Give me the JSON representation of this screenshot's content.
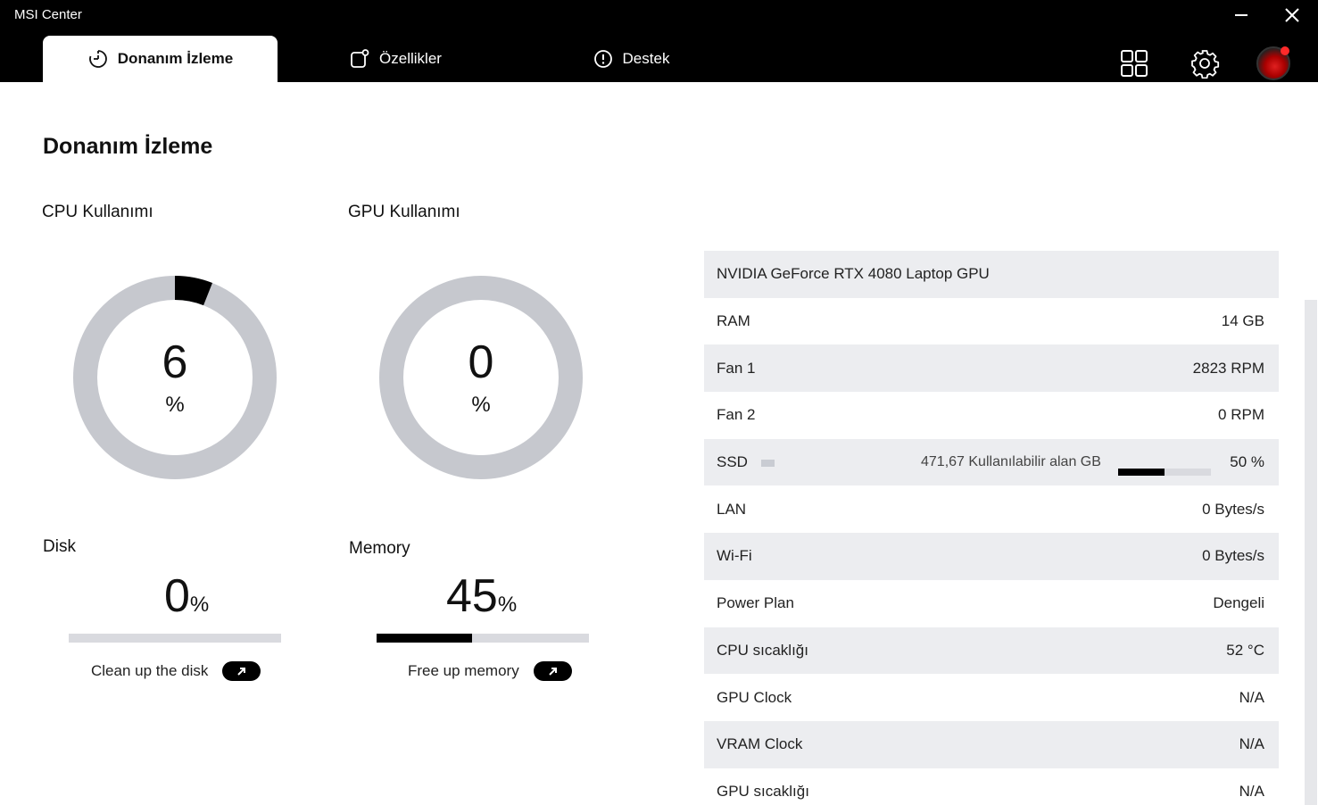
{
  "window": {
    "title": "MSI Center"
  },
  "tabs": [
    {
      "label": "Donanım İzleme",
      "icon": "monitor-timer-icon",
      "active": true
    },
    {
      "label": "Özellikler",
      "icon": "features-icon",
      "active": false
    },
    {
      "label": "Destek",
      "icon": "support-icon",
      "active": false
    }
  ],
  "header_icons": [
    "grid-icon",
    "gear-icon",
    "avatar"
  ],
  "page": {
    "title": "Donanım İzleme"
  },
  "cpu": {
    "title": "CPU Kullanımı",
    "value": "6",
    "unit": "%",
    "fraction": 0.06
  },
  "gpu": {
    "title": "GPU Kullanımı",
    "value": "0",
    "unit": "%",
    "fraction": 0.0
  },
  "disk": {
    "title": "Disk",
    "value": "0",
    "unit": "%",
    "fraction": 0.0,
    "action": "Clean up the disk"
  },
  "memory": {
    "title": "Memory",
    "value": "45",
    "unit": "%",
    "fraction": 0.45,
    "action": "Free up memory"
  },
  "info": {
    "gpu_name": "NVIDIA GeForce RTX 4080 Laptop GPU",
    "rows": [
      {
        "label": "RAM",
        "value": "14 GB"
      },
      {
        "label": "Fan 1",
        "value": "2823 RPM"
      },
      {
        "label": "Fan 2",
        "value": "0 RPM"
      }
    ],
    "ssd": {
      "label": "SSD",
      "free": "471,67 Kullanılabilir alan GB",
      "percent": "50 %",
      "fraction": 0.5
    },
    "rows2": [
      {
        "label": "LAN",
        "value": "0 Bytes/s"
      },
      {
        "label": "Wi-Fi",
        "value": "0 Bytes/s"
      },
      {
        "label": "Power Plan",
        "value": "Dengeli"
      },
      {
        "label": "CPU sıcaklığı",
        "value": "52 °C"
      },
      {
        "label": "GPU Clock",
        "value": "N/A"
      },
      {
        "label": "VRAM Clock",
        "value": "N/A"
      },
      {
        "label": "GPU sıcaklığı",
        "value": "N/A"
      }
    ]
  },
  "colors": {
    "header_bg": "#000000",
    "gauge_track": "#c6c8ce",
    "gauge_fill": "#000000",
    "row_alt": "#ecedf0"
  }
}
